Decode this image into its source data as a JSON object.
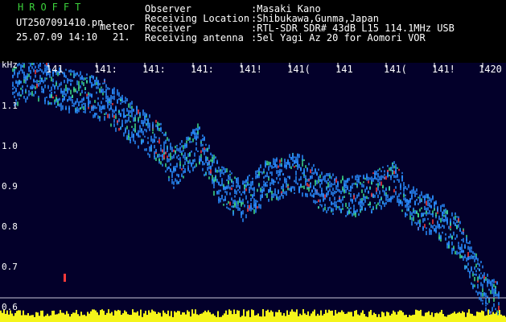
{
  "header": {
    "brand": "HROFFT",
    "filename": "UT2507091410.pn",
    "mode": "meteor",
    "datetime": "25.07.09 14:10",
    "count": "21.",
    "info": [
      {
        "label": "Observer",
        "value": ":Masaki Kano"
      },
      {
        "label": "Receiving Location",
        "value": ":Shibukawa,Gunma,Japan"
      },
      {
        "label": "Receiver",
        "value": ":RTL-SDR SDR# 43dB L15 114.1MHz USB"
      },
      {
        "label": "Receiving antenna",
        "value": ":5el Yagi Az 20 for Aomori VOR"
      }
    ]
  },
  "plot": {
    "y_unit": "kHz",
    "y_ticks": [
      "1.1",
      "1.0",
      "0.9",
      "0.8",
      "0.7",
      "0.6"
    ],
    "x_ticks": [
      "141",
      "141:",
      "141:",
      "141:",
      "141!",
      "141(",
      "141",
      "141(",
      "141!",
      "1420"
    ],
    "colors": {
      "background": "#03002a",
      "noise_floor": "#f5f51a",
      "trace": "#2a8cff",
      "hot": "#ff3a3a",
      "header_brand": "#3cd23c"
    }
  }
}
